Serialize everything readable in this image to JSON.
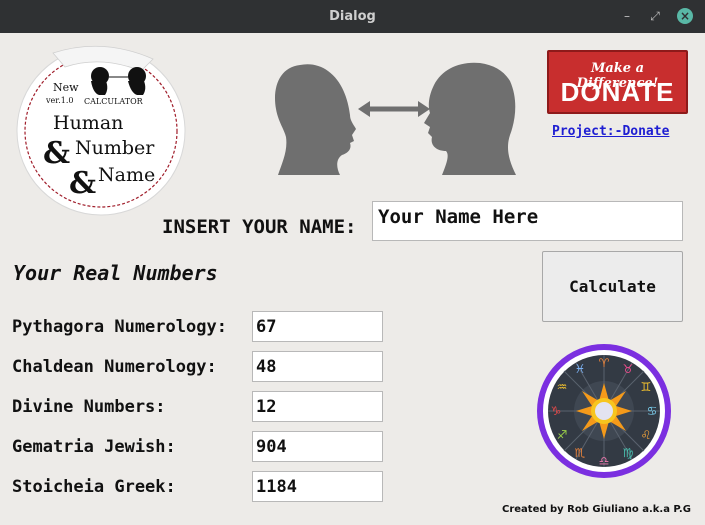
{
  "window": {
    "title": "Dialog",
    "minimize_glyph": "–",
    "maximize_glyph": "⤢",
    "close_glyph": "×"
  },
  "logo": {
    "line_new": "New",
    "line_ver": "ver.1.0",
    "line_calculator": "CALCULATOR",
    "line_human": "Human",
    "line_number": "Number",
    "line_name": "Name",
    "ampersand": "&"
  },
  "donate": {
    "tagline": "Make a Difference!",
    "label": "DONATE",
    "link": "Project:-Donate "
  },
  "name_field": {
    "label": "INSERT YOUR NAME:",
    "value": "Your Name Here"
  },
  "section_title": "Your Real Numbers",
  "calculate_label": "Calculate",
  "results": [
    {
      "label": "Pythagora Numerology:",
      "value": "67"
    },
    {
      "label": "Chaldean Numerology:",
      "value": "48"
    },
    {
      "label": "Divine Numbers:",
      "value": "12"
    },
    {
      "label": "Gematria Jewish:",
      "value": "904"
    },
    {
      "label": "Stoicheia Greek:",
      "value": "1184"
    }
  ],
  "credit": "Created by Rob Giuliano a.k.a P.G",
  "colors": {
    "accent_donate": "#c82e2e",
    "link": "#1e1ed2",
    "zodiac_ring": "#7b2fe0"
  }
}
